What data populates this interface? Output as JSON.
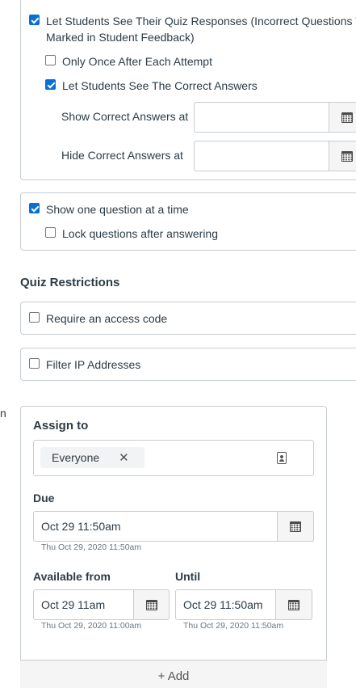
{
  "feedback": {
    "see_responses_label": "Let Students See Their Quiz Responses (Incorrect Questions W",
    "see_responses_label_line2": "Marked in Student Feedback)",
    "only_once_label": "Only Once After Each Attempt",
    "see_correct_label": "Let Students See The Correct Answers",
    "show_correct_at_label": "Show Correct Answers at",
    "show_correct_at_value": "",
    "hide_correct_at_label": "Hide Correct Answers at",
    "hide_correct_at_value": ""
  },
  "question_display": {
    "one_at_a_time_label": "Show one question at a time",
    "lock_after_answer_label": "Lock questions after answering"
  },
  "restrictions": {
    "heading": "Quiz Restrictions",
    "access_code_label": "Require an access code",
    "filter_ip_label": "Filter IP Addresses"
  },
  "left_edge_fragment": "n",
  "assign": {
    "heading": "Assign to",
    "assignee_token": "Everyone",
    "remove_symbol": "✕",
    "due_label": "Due",
    "due_value": "Oct 29 11:50am",
    "due_hint": "Thu Oct 29, 2020 11:50am",
    "available_label": "Available from",
    "available_value": "Oct 29 11am",
    "available_hint": "Thu Oct 29, 2020 11:00am",
    "until_label": "Until",
    "until_value": "Oct 29 11:50am",
    "until_hint": "Thu Oct 29, 2020 11:50am",
    "add_label": "+ Add"
  },
  "checkbox_states": {
    "see_responses": true,
    "only_once": false,
    "see_correct": true,
    "one_at_a_time": true,
    "lock_after_answer": false,
    "access_code": false,
    "filter_ip": false
  },
  "icons": [
    "calendar-icon",
    "close-icon",
    "address-book-icon",
    "plus-icon"
  ],
  "colors": {
    "accent": "#0770d7",
    "border": "#c7cdd1",
    "text": "#2d3b45",
    "hint": "#6b7780"
  }
}
